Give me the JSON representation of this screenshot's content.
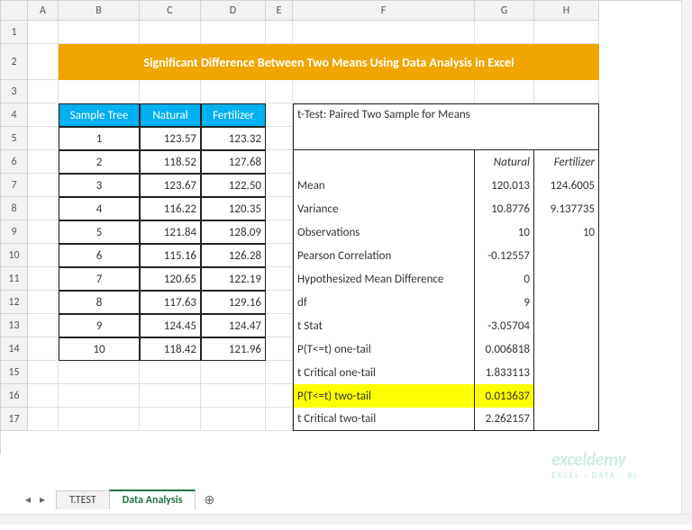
{
  "columns": [
    "",
    "A",
    "B",
    "C",
    "D",
    "E",
    "F",
    "G",
    "H"
  ],
  "rows": [
    "1",
    "2",
    "3",
    "4",
    "5",
    "6",
    "7",
    "8",
    "9",
    "10",
    "11",
    "12",
    "13",
    "14",
    "15",
    "16",
    "17"
  ],
  "title": "Significant Difference Between Two Means Using Data Analysis in Excel",
  "data_table": {
    "headers": [
      "Sample Tree",
      "Natural",
      "Fertilizer"
    ],
    "rows": [
      {
        "n": "1",
        "a": "123.57",
        "b": "123.32"
      },
      {
        "n": "2",
        "a": "118.52",
        "b": "127.68"
      },
      {
        "n": "3",
        "a": "123.67",
        "b": "122.50"
      },
      {
        "n": "4",
        "a": "116.22",
        "b": "120.35"
      },
      {
        "n": "5",
        "a": "121.84",
        "b": "128.09"
      },
      {
        "n": "6",
        "a": "115.16",
        "b": "126.28"
      },
      {
        "n": "7",
        "a": "120.65",
        "b": "122.19"
      },
      {
        "n": "8",
        "a": "117.63",
        "b": "129.16"
      },
      {
        "n": "9",
        "a": "124.45",
        "b": "124.47"
      },
      {
        "n": "10",
        "a": "118.42",
        "b": "121.96"
      }
    ]
  },
  "ttest": {
    "title": "t-Test: Paired Two Sample for Means",
    "col1": "Natural",
    "col2": "Fertilizer",
    "stats": [
      {
        "label": "Mean",
        "v1": "120.013",
        "v2": "124.6005"
      },
      {
        "label": "Variance",
        "v1": "10.8776",
        "v2": "9.137735"
      },
      {
        "label": "Observations",
        "v1": "10",
        "v2": "10"
      },
      {
        "label": "Pearson Correlation",
        "v1": "-0.12557",
        "v2": ""
      },
      {
        "label": "Hypothesized Mean Difference",
        "v1": "0",
        "v2": ""
      },
      {
        "label": "df",
        "v1": "9",
        "v2": ""
      },
      {
        "label": "t Stat",
        "v1": "-3.05704",
        "v2": ""
      },
      {
        "label": "P(T<=t) one-tail",
        "v1": "0.006818",
        "v2": ""
      },
      {
        "label": "t Critical one-tail",
        "v1": "1.833113",
        "v2": ""
      },
      {
        "label": "P(T<=t) two-tail",
        "v1": "0.013637",
        "v2": "",
        "hl": true
      },
      {
        "label": "t Critical two-tail",
        "v1": "2.262157",
        "v2": ""
      }
    ]
  },
  "tabs": {
    "t1": "T.TEST",
    "t2": "Data Analysis"
  },
  "watermark": {
    "name": "exceldemy",
    "tag": "EXCEL · DATA · BI"
  }
}
